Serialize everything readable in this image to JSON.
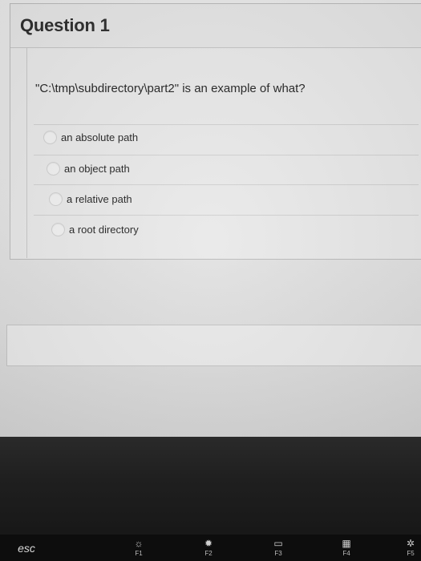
{
  "question": {
    "title": "Question 1",
    "prompt": "\"C:\\tmp\\subdirectory\\part2\" is an example of what?",
    "options": [
      {
        "label": "an absolute path"
      },
      {
        "label": "an object path"
      },
      {
        "label": "a relative path"
      },
      {
        "label": "a root directory"
      }
    ]
  },
  "keyboard": {
    "esc": "esc",
    "keys": [
      {
        "label": "F1",
        "icon": "brightness-down-icon"
      },
      {
        "label": "F2",
        "icon": "brightness-up-icon"
      },
      {
        "label": "F3",
        "icon": "mission-control-icon"
      },
      {
        "label": "F4",
        "icon": "launchpad-icon"
      },
      {
        "label": "F5",
        "icon": "keyboard-backlight-icon"
      }
    ]
  }
}
